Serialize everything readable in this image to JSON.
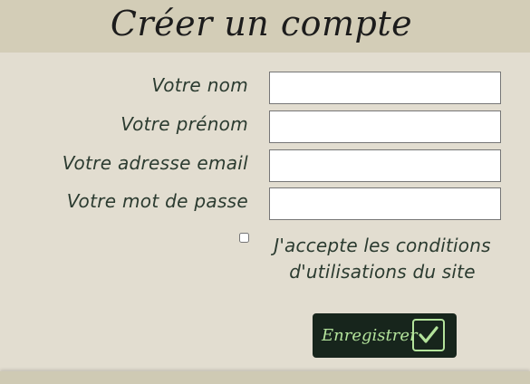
{
  "header": {
    "title": "Créer un compte"
  },
  "form": {
    "fields": [
      {
        "label": "Votre nom",
        "value": "",
        "placeholder": ""
      },
      {
        "label": "Votre prénom",
        "value": "",
        "placeholder": ""
      },
      {
        "label": "Votre adresse email",
        "value": "",
        "placeholder": ""
      },
      {
        "label": "Votre mot de passe",
        "value": "",
        "placeholder": ""
      }
    ],
    "terms": {
      "checked": false,
      "line1": "J'accepte les conditions",
      "line2": "d'utilisations du site"
    },
    "submit": {
      "label": "Enregistrer",
      "icon": "check-icon"
    }
  },
  "colors": {
    "page_background": "#e2ddd0",
    "header_background": "#d3cdb7",
    "label_text": "#2b3b30",
    "button_background": "#17251c",
    "button_accent": "#b3e39b"
  }
}
